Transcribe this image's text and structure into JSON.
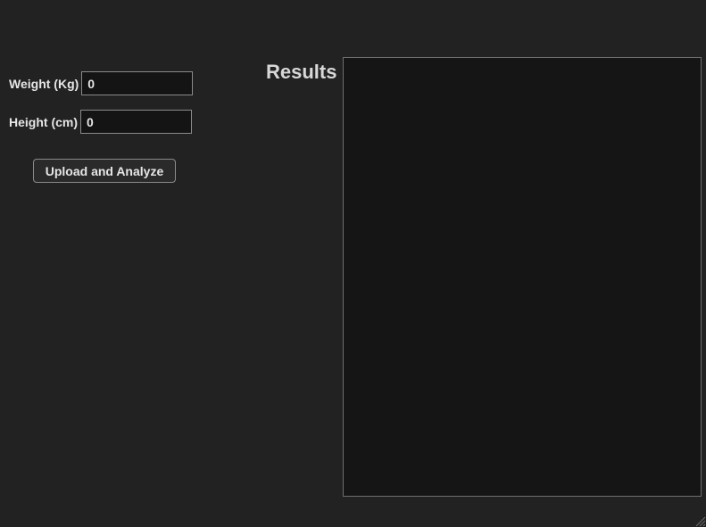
{
  "form": {
    "weight": {
      "label": "Weight (Kg)",
      "value": "0"
    },
    "height": {
      "label": "Height (cm)",
      "value": "0"
    },
    "submit_label": "Upload and Analyze"
  },
  "results": {
    "title": "Results"
  },
  "colors": {
    "background": "#222222",
    "panel": "#151515",
    "text": "#e6e6e6",
    "border": "#8a8a8a"
  },
  "icons": {
    "resize_grip": "resize-grip-icon"
  }
}
